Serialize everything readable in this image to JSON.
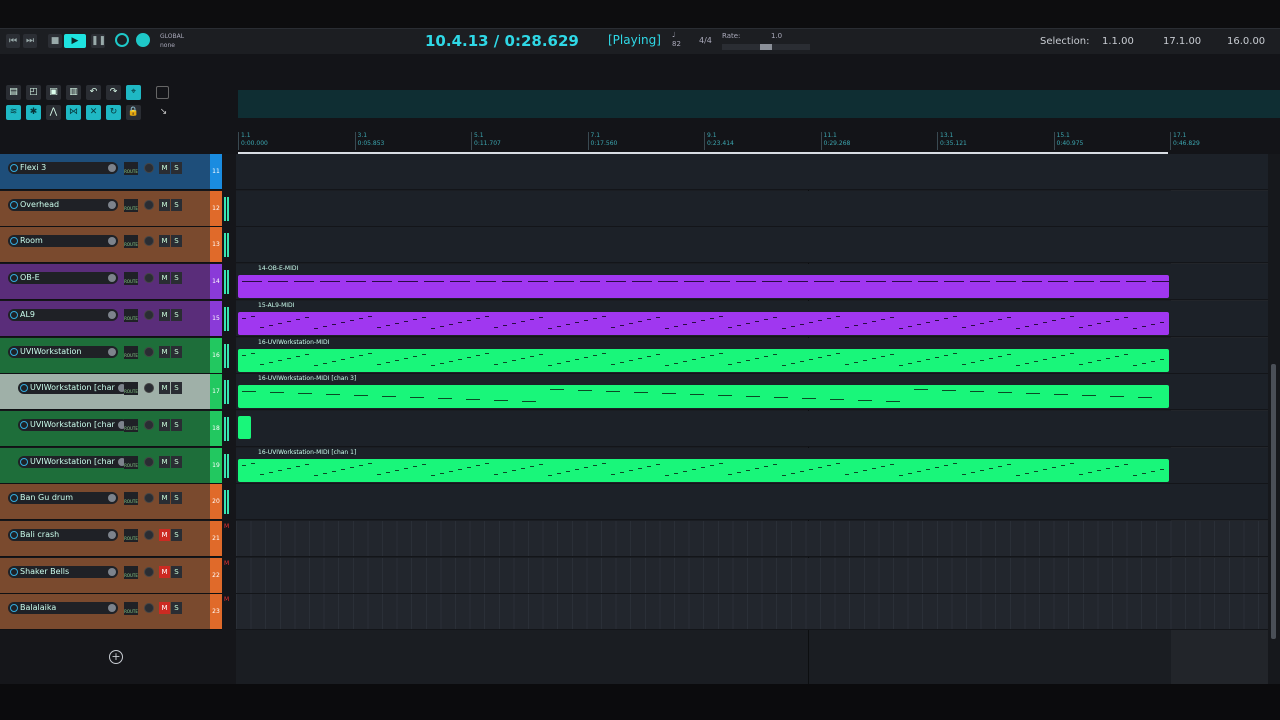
{
  "transport": {
    "position": "10.4.13 / 0:28.629",
    "status": "[Playing]",
    "global_label": "GLOBAL",
    "global_value": "none",
    "tempo": "82",
    "time_signature": "4/4",
    "rate_label": "Rate:",
    "rate_value": "1.0",
    "selection_label": "Selection:",
    "selection_start": "1.1.00",
    "selection_end": "17.1.00",
    "selection_length": "16.0.00",
    "accent": "#2fd8e6"
  },
  "ruler": {
    "marks": [
      {
        "bar": "1.1",
        "time": "0:00.000"
      },
      {
        "bar": "3.1",
        "time": "0:05.853"
      },
      {
        "bar": "5.1",
        "time": "0:11.707"
      },
      {
        "bar": "7.1",
        "time": "0:17.560"
      },
      {
        "bar": "9.1",
        "time": "0:23.414"
      },
      {
        "bar": "11.1",
        "time": "0:29.268"
      },
      {
        "bar": "13.1",
        "time": "0:35.121"
      },
      {
        "bar": "15.1",
        "time": "0:40.975"
      },
      {
        "bar": "17.1",
        "time": "0:46.829"
      }
    ]
  },
  "tracks": [
    {
      "name": "Flexi 3",
      "number": "11",
      "color": "#1e4e7a",
      "num_color": "#1a8ce0",
      "muted": false
    },
    {
      "name": "Overhead",
      "number": "12",
      "color": "#7a4a2e",
      "num_color": "#e06a2a",
      "muted": false
    },
    {
      "name": "Room",
      "number": "13",
      "color": "#7a4a2e",
      "num_color": "#e06a2a",
      "muted": false
    },
    {
      "name": "OB-E",
      "number": "14",
      "color": "#5a2d7a",
      "num_color": "#8a3ad8",
      "muted": false
    },
    {
      "name": "AL9",
      "number": "15",
      "color": "#5a2d7a",
      "num_color": "#8a3ad8",
      "muted": false
    },
    {
      "name": "UVIWorkstation",
      "number": "16",
      "color": "#1e6e3a",
      "num_color": "#22c860",
      "muted": false
    },
    {
      "name": "UVIWorkstation [char",
      "number": "17",
      "color": "#9fb0a8",
      "num_color": "#22c860",
      "muted": false
    },
    {
      "name": "UVIWorkstation [char",
      "number": "18",
      "color": "#1e6e3a",
      "num_color": "#22c860",
      "muted": false
    },
    {
      "name": "UVIWorkstation [char",
      "number": "19",
      "color": "#1e6e3a",
      "num_color": "#22c860",
      "muted": false
    },
    {
      "name": "Ban Gu drum",
      "number": "20",
      "color": "#7a4a2e",
      "num_color": "#e06a2a",
      "muted": false
    },
    {
      "name": "Bali crash",
      "number": "21",
      "color": "#7a4a2e",
      "num_color": "#e06a2a",
      "muted": true
    },
    {
      "name": "Shaker Bells",
      "number": "22",
      "color": "#7a4a2e",
      "num_color": "#e06a2a",
      "muted": true
    },
    {
      "name": "Balalaika",
      "number": "23",
      "color": "#7a4a2e",
      "num_color": "#e06a2a",
      "muted": true
    }
  ],
  "clips": [
    {
      "lane": 3,
      "label": "14-OB-E-MIDI",
      "color": "purple"
    },
    {
      "lane": 4,
      "label": "15-AL9-MIDI",
      "color": "purple"
    },
    {
      "lane": 5,
      "label": "16-UVIWorkstation-MIDI",
      "color": "green"
    },
    {
      "lane": 6,
      "label": "16-UVIWorkstation-MIDI [chan 3]",
      "color": "green"
    },
    {
      "lane": 8,
      "label": "16-UVIWorkstation-MIDI [chan 1]",
      "color": "green"
    }
  ],
  "track_buttons": {
    "mute": "M",
    "solo": "S",
    "route": "ROUTE"
  },
  "icons": [
    "undo-icon",
    "redo-icon",
    "grid-icon",
    "snap-icon",
    "loop-icon",
    "lock-icon",
    "envelope-icon",
    "trim-icon",
    "add-track-icon"
  ]
}
